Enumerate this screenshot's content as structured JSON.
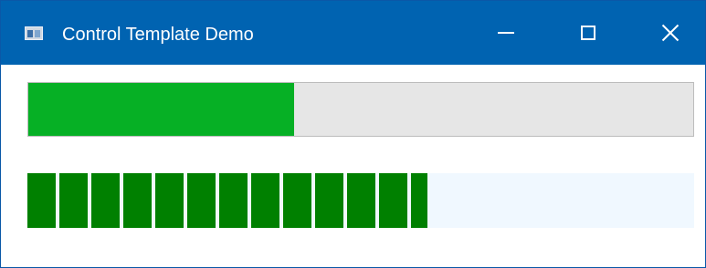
{
  "window": {
    "title": "Control Template Demo",
    "icon": "app-window-icon",
    "controls": {
      "minimize_icon": "minimize-icon",
      "maximize_icon": "maximize-icon",
      "close_icon": "close-icon"
    }
  },
  "progress_bars": [
    {
      "style": "standard",
      "value": 0.4,
      "fill_color": "#06b025",
      "track_color": "#e6e6e6"
    },
    {
      "style": "segmented",
      "value": 0.6,
      "fill_color": "#008000",
      "track_color": "#f0f8ff"
    }
  ],
  "colors": {
    "titlebar": "#0063b1"
  }
}
